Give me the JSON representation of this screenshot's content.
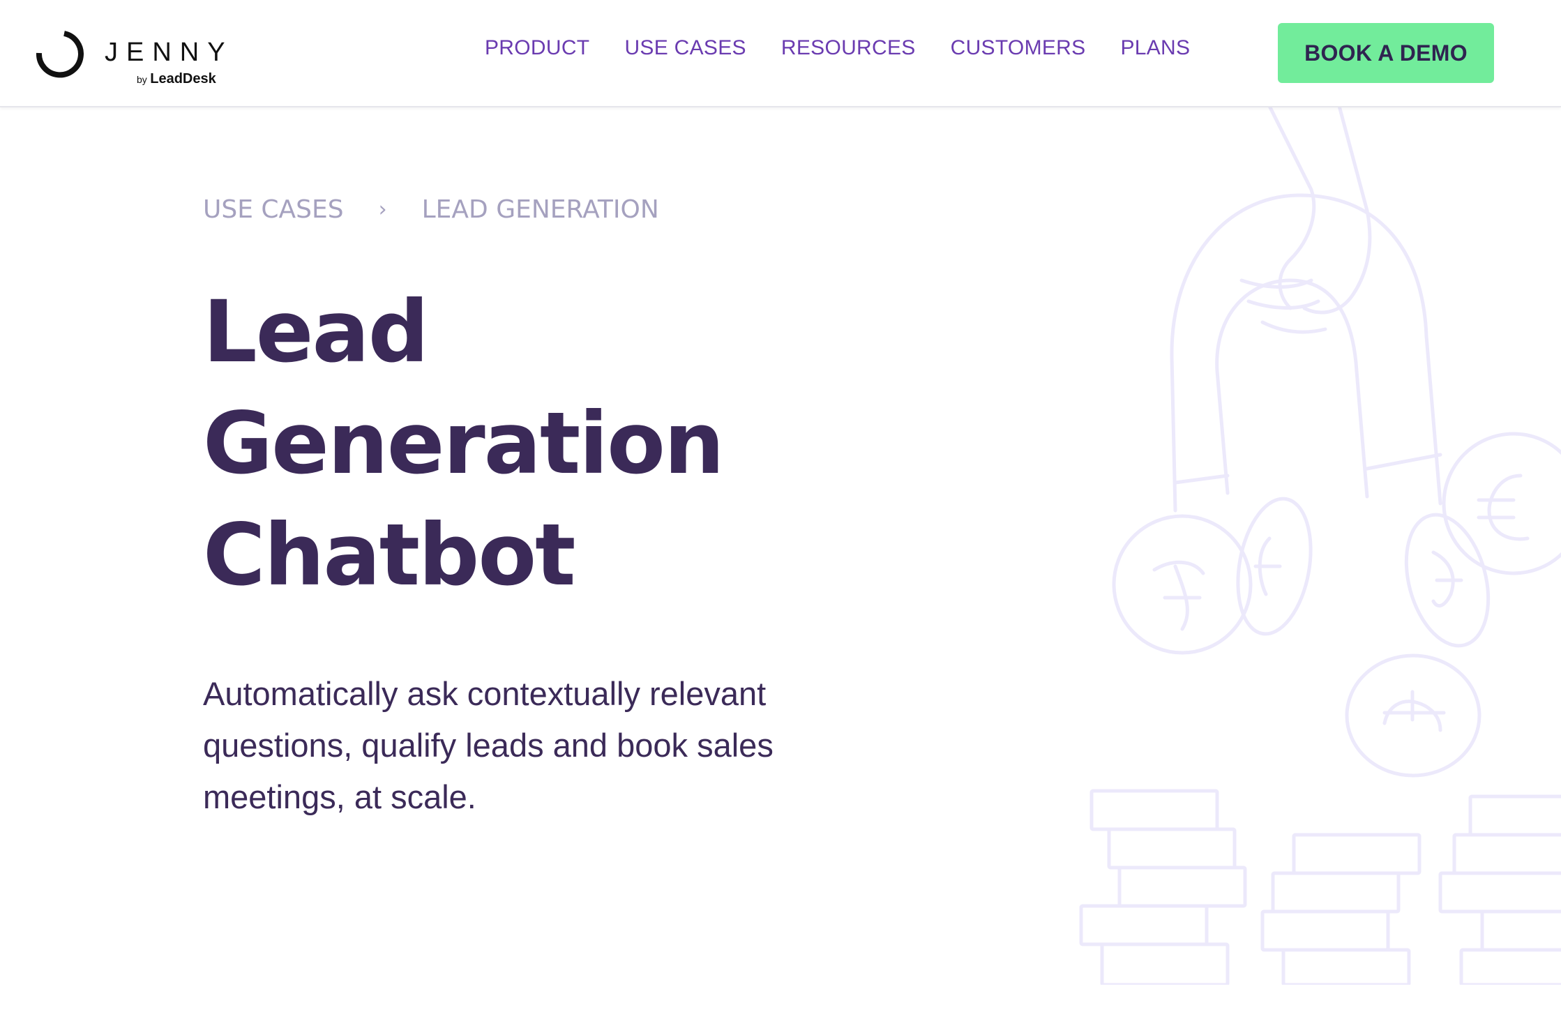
{
  "logo": {
    "name": "JENNY",
    "by": "by",
    "brand": "LeadDesk"
  },
  "nav": {
    "items": [
      {
        "label": "PRODUCT"
      },
      {
        "label": "USE CASES"
      },
      {
        "label": "RESOURCES"
      },
      {
        "label": "CUSTOMERS"
      },
      {
        "label": "PLANS"
      }
    ]
  },
  "cta": {
    "label": "BOOK A DEMO"
  },
  "breadcrumb": {
    "items": [
      "USE CASES",
      "LEAD GENERATION"
    ],
    "separator": "›"
  },
  "hero": {
    "title_lines": [
      "Lead",
      "Generation",
      "Chatbot"
    ],
    "subtitle": "Automatically ask contextually relevant questions, qualify leads and book sales meetings, at scale."
  },
  "colors": {
    "nav_text": "#6a3bb0",
    "cta_bg": "#72ec9b",
    "cta_text": "#2f2450",
    "heading": "#3b2a58",
    "breadcrumb": "#a5a1bf",
    "illustration_stroke": "#ece9fb"
  },
  "icons": {
    "logo": "ring-logo-icon",
    "illustration": "magnet-coins-illustration"
  }
}
